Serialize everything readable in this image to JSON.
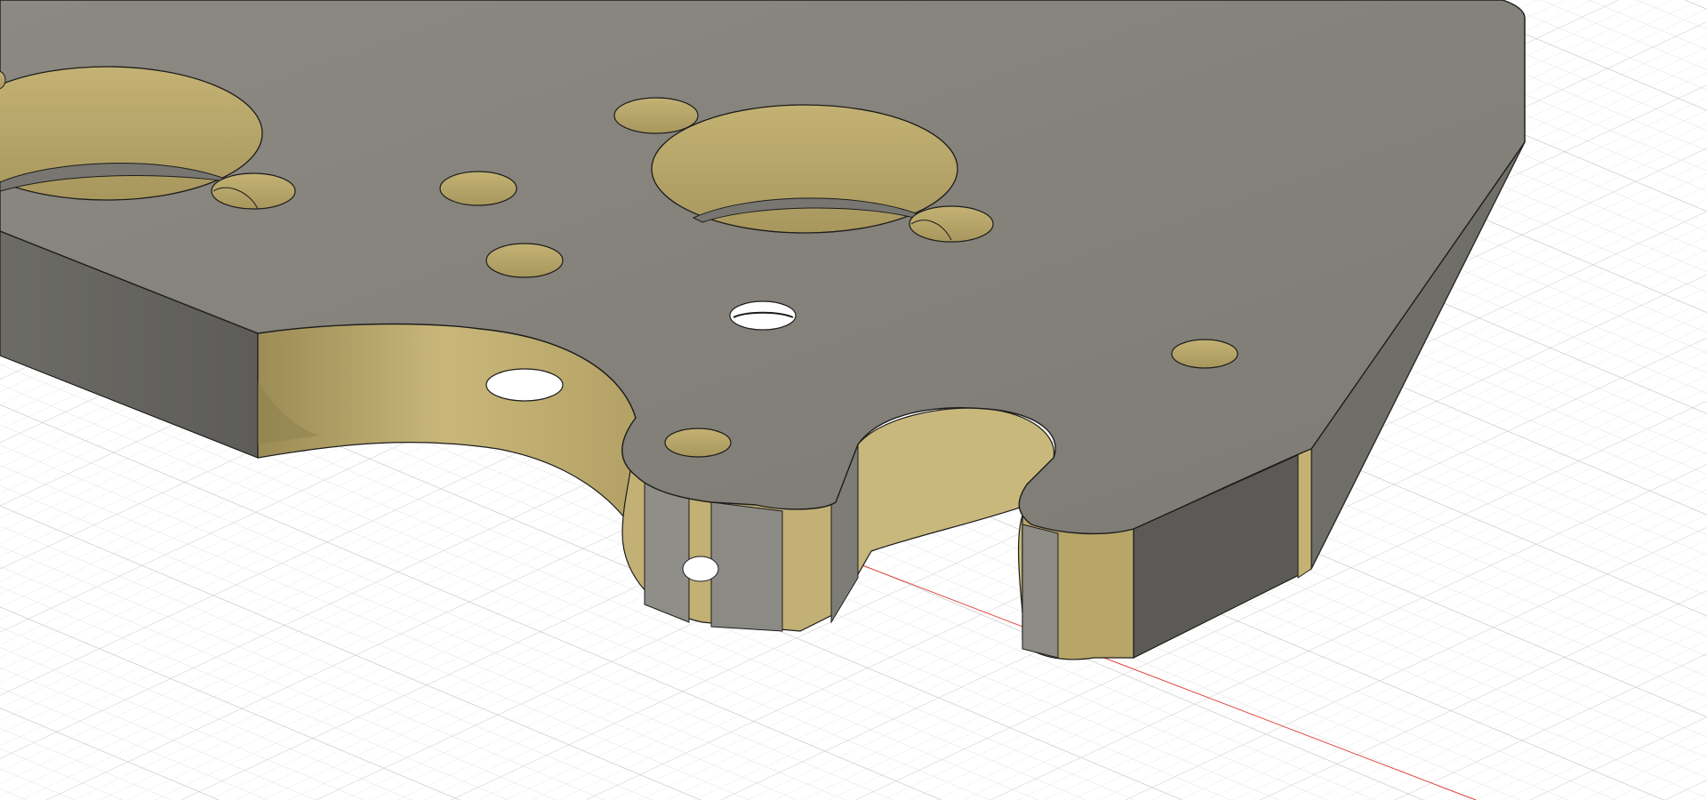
{
  "viewport": {
    "background": "#ffffff",
    "grid_color": "#d6d6d6",
    "grid_major_color": "#c4c4c4",
    "axis_x_color": "#e0453a"
  },
  "part": {
    "top_face_color": "#85837b",
    "side_face_color": "#6e6c66",
    "side_face_dark_color": "#5c5b57",
    "hole_wall_color": "#b8a66a",
    "hole_wall_shadow_color": "#8f8150",
    "edge_color": "#1c1c1c"
  }
}
